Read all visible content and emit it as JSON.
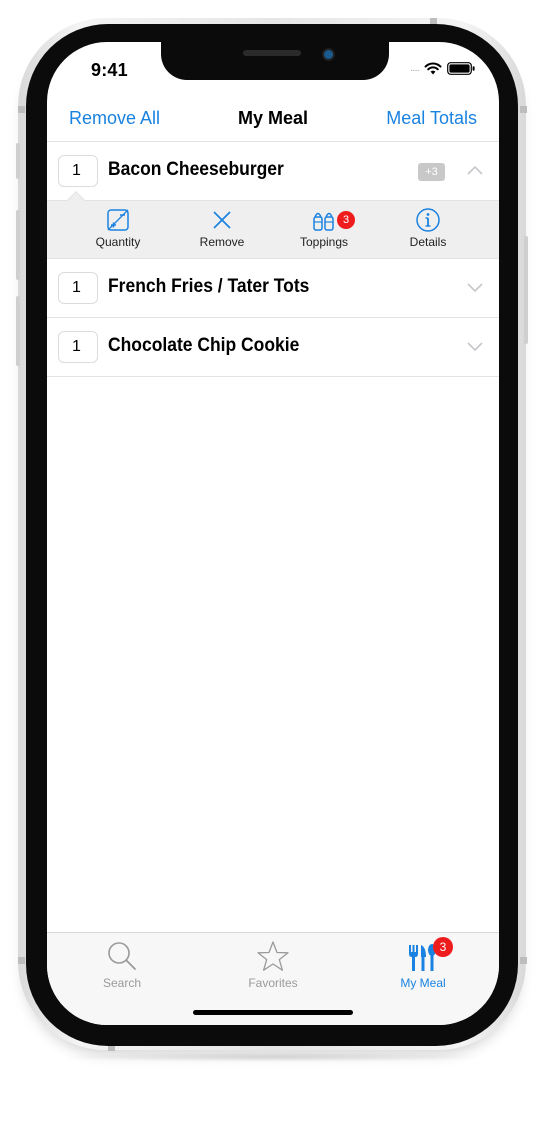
{
  "status_bar": {
    "time": "9:41",
    "signal": "....."
  },
  "nav": {
    "left_button": "Remove All",
    "title": "My Meal",
    "right_button": "Meal Totals"
  },
  "meal_items": [
    {
      "quantity": "1",
      "name": "Bacon Cheeseburger",
      "modifier_badge": "+3",
      "expanded": true
    },
    {
      "quantity": "1",
      "name": "French Fries / Tater Tots",
      "expanded": false
    },
    {
      "quantity": "1",
      "name": "Chocolate Chip Cookie",
      "expanded": false
    }
  ],
  "actions": [
    {
      "label": "Quantity",
      "icon": "quantity-icon"
    },
    {
      "label": "Remove",
      "icon": "x-icon"
    },
    {
      "label": "Toppings",
      "icon": "shakers-icon",
      "badge": "3"
    },
    {
      "label": "Details",
      "icon": "info-icon"
    }
  ],
  "tabs": [
    {
      "label": "Search",
      "icon": "search-icon",
      "active": false
    },
    {
      "label": "Favorites",
      "icon": "star-icon",
      "active": false
    },
    {
      "label": "My Meal",
      "icon": "utensils-icon",
      "active": true,
      "badge": "3"
    }
  ],
  "colors": {
    "accent": "#1a82e0",
    "badge": "#ee1c1c",
    "inactive": "#9a9a9a"
  }
}
